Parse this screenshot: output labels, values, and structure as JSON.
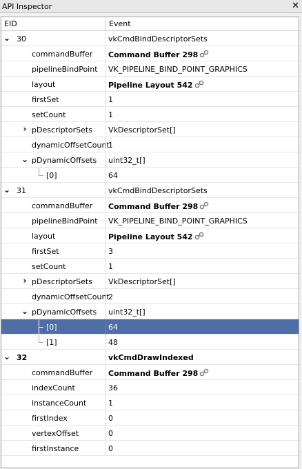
{
  "window": {
    "title": "API Inspector"
  },
  "columns": {
    "eid": "EID",
    "event": "Event"
  },
  "calls": [
    {
      "eid": "30",
      "event": "vkCmdBindDescriptorSets",
      "params": [
        {
          "name": "commandBuffer",
          "value": "Command Buffer 298",
          "link": true
        },
        {
          "name": "pipelineBindPoint",
          "value": "VK_PIPELINE_BIND_POINT_GRAPHICS"
        },
        {
          "name": "layout",
          "value": "Pipeline Layout 542",
          "link": true
        },
        {
          "name": "firstSet",
          "value": "1"
        },
        {
          "name": "setCount",
          "value": "1"
        },
        {
          "name": "pDescriptorSets",
          "value": "VkDescriptorSet[]"
        },
        {
          "name": "dynamicOffsetCount",
          "value": "1"
        },
        {
          "name": "pDynamicOffsets",
          "value": "uint32_t[]"
        },
        {
          "name": "[0]",
          "value": "64"
        }
      ]
    },
    {
      "eid": "31",
      "event": "vkCmdBindDescriptorSets",
      "params": [
        {
          "name": "commandBuffer",
          "value": "Command Buffer 298",
          "link": true
        },
        {
          "name": "pipelineBindPoint",
          "value": "VK_PIPELINE_BIND_POINT_GRAPHICS"
        },
        {
          "name": "layout",
          "value": "Pipeline Layout 542",
          "link": true
        },
        {
          "name": "firstSet",
          "value": "3"
        },
        {
          "name": "setCount",
          "value": "1"
        },
        {
          "name": "pDescriptorSets",
          "value": "VkDescriptorSet[]"
        },
        {
          "name": "dynamicOffsetCount",
          "value": "2"
        },
        {
          "name": "pDynamicOffsets",
          "value": "uint32_t[]"
        },
        {
          "name": "[0]",
          "value": "64"
        },
        {
          "name": "[1]",
          "value": "48"
        }
      ]
    },
    {
      "eid": "32",
      "event": "vkCmdDrawIndexed",
      "params": [
        {
          "name": "commandBuffer",
          "value": "Command Buffer 298",
          "link": true
        },
        {
          "name": "indexCount",
          "value": "36"
        },
        {
          "name": "instanceCount",
          "value": "1"
        },
        {
          "name": "firstIndex",
          "value": "0"
        },
        {
          "name": "vertexOffset",
          "value": "0"
        },
        {
          "name": "firstInstance",
          "value": "0"
        }
      ]
    }
  ],
  "colors": {
    "selection": "#4f6ea6",
    "border": "#a0a0a0"
  }
}
